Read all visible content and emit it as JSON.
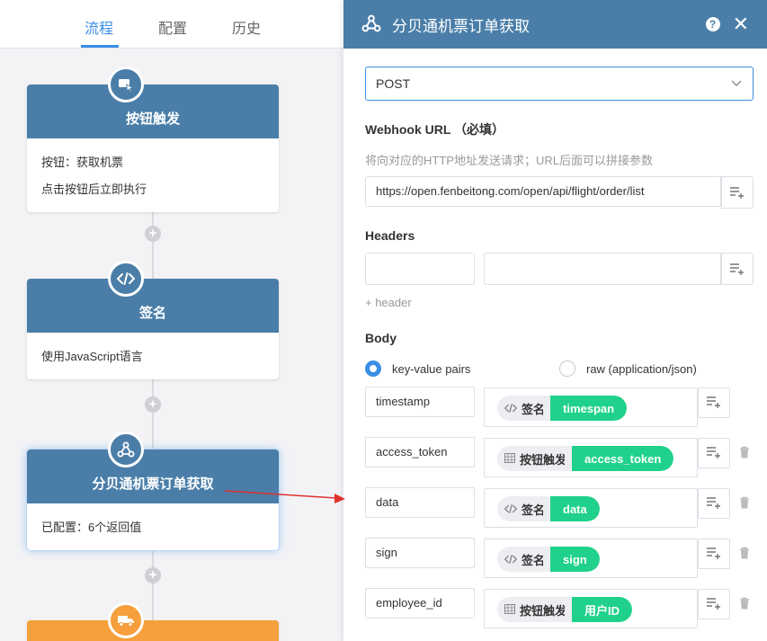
{
  "tabs": [
    {
      "label": "流程",
      "active": true
    },
    {
      "label": "配置",
      "active": false
    },
    {
      "label": "历史",
      "active": false
    }
  ],
  "flow": {
    "nodes": [
      {
        "title": "按钮触发",
        "lines": [
          "按钮：获取机票",
          "点击按钮后立即执行"
        ],
        "icon": "cursor-click-icon",
        "color": "#4a7ea8"
      },
      {
        "title": "签名",
        "lines": [
          "使用JavaScript语言"
        ],
        "icon": "code-icon",
        "color": "#4a7ea8"
      },
      {
        "title": "分贝通机票订单获取",
        "lines": [
          "已配置：6个返回值"
        ],
        "icon": "webhook-icon",
        "color": "#4a7ea8",
        "selected": true
      },
      {
        "title": "",
        "lines": [],
        "icon": "truck-icon",
        "color": "#f5a03c"
      }
    ],
    "add_symbol": "+"
  },
  "panel": {
    "title": "分贝通机票订单获取",
    "help": "?",
    "close": "✕",
    "method": "POST",
    "webhook_label": "Webhook URL （必填）",
    "webhook_hint": "将向对应的HTTP地址发送请求；URL后面可以拼接参数",
    "webhook_value": "https://open.fenbeitong.com/open/api/flight/order/list",
    "headers_label": "Headers",
    "add_header": "+ header",
    "body_label": "Body",
    "body_modes": [
      {
        "label": "key-value pairs",
        "selected": true
      },
      {
        "label": "raw (application/json)",
        "selected": false
      }
    ],
    "pairs": [
      {
        "key": "timestamp",
        "source": "签名",
        "source_icon": "code-icon",
        "field": "timespan",
        "deletable": false
      },
      {
        "key": "access_token",
        "source": "按钮触发",
        "source_icon": "table-icon",
        "field": "access_token",
        "deletable": true
      },
      {
        "key": "data",
        "source": "签名",
        "source_icon": "code-icon",
        "field": "data",
        "deletable": true
      },
      {
        "key": "sign",
        "source": "签名",
        "source_icon": "code-icon",
        "field": "sign",
        "deletable": true
      },
      {
        "key": "employee_id",
        "source": "按钮触发",
        "source_icon": "table-icon",
        "field": "用户ID",
        "deletable": true
      }
    ]
  },
  "colors": {
    "accent": "#3a8ee6",
    "node": "#4a7ea8",
    "tag": "#1fd18a",
    "arrow": "#e03131"
  }
}
